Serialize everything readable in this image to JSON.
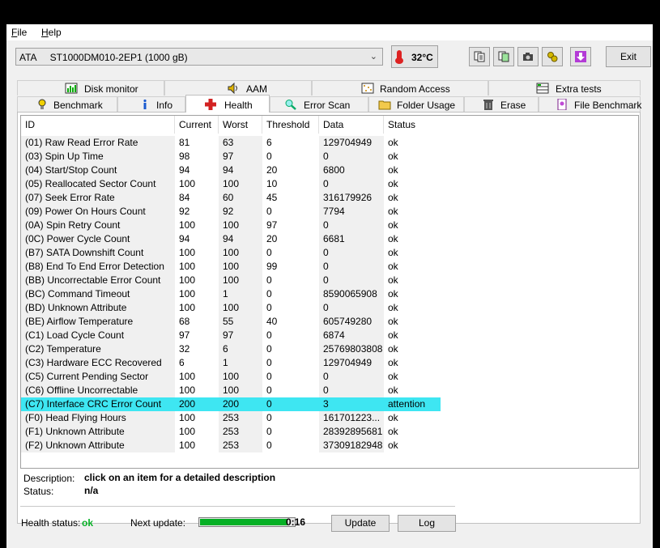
{
  "menu": {
    "file": "File",
    "file_key": "F",
    "file_rest": "ile",
    "help": "Help",
    "help_key": "H",
    "help_rest": "elp"
  },
  "toolbar": {
    "drive": "ATA     ST1000DM010-2EP1 (1000 gB)",
    "temperature": "32°C",
    "exit_label": "Exit"
  },
  "tabs_top": [
    {
      "label": "Disk monitor",
      "icon": "chart-icon"
    },
    {
      "label": "AAM",
      "icon": "speaker-icon"
    },
    {
      "label": "Random Access",
      "icon": "dots-icon"
    },
    {
      "label": "Extra tests",
      "icon": "grid-icon"
    }
  ],
  "tabs_bottom": [
    {
      "label": "Benchmark",
      "icon": "bulb-icon"
    },
    {
      "label": "Info",
      "icon": "info-icon"
    },
    {
      "label": "Health",
      "icon": "cross-icon",
      "active": true
    },
    {
      "label": "Error Scan",
      "icon": "magnifier-icon"
    },
    {
      "label": "Folder Usage",
      "icon": "folder-icon"
    },
    {
      "label": "Erase",
      "icon": "trash-icon"
    },
    {
      "label": "File Benchmark",
      "icon": "file-icon"
    }
  ],
  "table": {
    "headers": [
      "ID",
      "Current",
      "Worst",
      "Threshold",
      "Data",
      "Status"
    ],
    "rows": [
      [
        "(01) Raw Read Error Rate",
        "81",
        "63",
        "6",
        "129704949",
        "ok"
      ],
      [
        "(03) Spin Up Time",
        "98",
        "97",
        "0",
        "0",
        "ok"
      ],
      [
        "(04) Start/Stop Count",
        "94",
        "94",
        "20",
        "6800",
        "ok"
      ],
      [
        "(05) Reallocated Sector Count",
        "100",
        "100",
        "10",
        "0",
        "ok"
      ],
      [
        "(07) Seek Error Rate",
        "84",
        "60",
        "45",
        "316179926",
        "ok"
      ],
      [
        "(09) Power On Hours Count",
        "92",
        "92",
        "0",
        "7794",
        "ok"
      ],
      [
        "(0A) Spin Retry Count",
        "100",
        "100",
        "97",
        "0",
        "ok"
      ],
      [
        "(0C) Power Cycle Count",
        "94",
        "94",
        "20",
        "6681",
        "ok"
      ],
      [
        "(B7) SATA Downshift Count",
        "100",
        "100",
        "0",
        "0",
        "ok"
      ],
      [
        "(B8) End To End Error Detection",
        "100",
        "100",
        "99",
        "0",
        "ok"
      ],
      [
        "(BB) Uncorrectable Error Count",
        "100",
        "100",
        "0",
        "0",
        "ok"
      ],
      [
        "(BC) Command Timeout",
        "100",
        "1",
        "0",
        "8590065908",
        "ok"
      ],
      [
        "(BD) Unknown Attribute",
        "100",
        "100",
        "0",
        "0",
        "ok"
      ],
      [
        "(BE) Airflow Temperature",
        "68",
        "55",
        "40",
        "605749280",
        "ok"
      ],
      [
        "(C1) Load Cycle Count",
        "97",
        "97",
        "0",
        "6874",
        "ok"
      ],
      [
        "(C2) Temperature",
        "32",
        "6",
        "0",
        "25769803808",
        "ok"
      ],
      [
        "(C3) Hardware ECC Recovered",
        "6",
        "1",
        "0",
        "129704949",
        "ok"
      ],
      [
        "(C5) Current Pending Sector",
        "100",
        "100",
        "0",
        "0",
        "ok"
      ],
      [
        "(C6) Offline Uncorrectable",
        "100",
        "100",
        "0",
        "0",
        "ok"
      ],
      [
        "(C7) Interface CRC Error Count",
        "200",
        "200",
        "0",
        "3",
        "attention"
      ],
      [
        "(F0) Head Flying Hours",
        "100",
        "253",
        "0",
        "161701223...",
        "ok"
      ],
      [
        "(F1) Unknown Attribute",
        "100",
        "253",
        "0",
        "28392895681",
        "ok"
      ],
      [
        "(F2) Unknown Attribute",
        "100",
        "253",
        "0",
        "37309182948",
        "ok"
      ]
    ],
    "selected_row": 19
  },
  "description": {
    "desc_label": "Description:",
    "desc_value": "click on an item for a detailed description",
    "status_label": "Status:",
    "status_value": "n/a"
  },
  "footer": {
    "health_label": "Health status:",
    "health_value": "ok",
    "next_label": "Next update:",
    "progress_fraction": 0.93,
    "countdown": "0:16",
    "update_label": "Update",
    "log_label": "Log"
  },
  "colors": {
    "selected_row": "#3ee6f2",
    "ok_green": "#06b025",
    "accent_red": "#d22222"
  }
}
